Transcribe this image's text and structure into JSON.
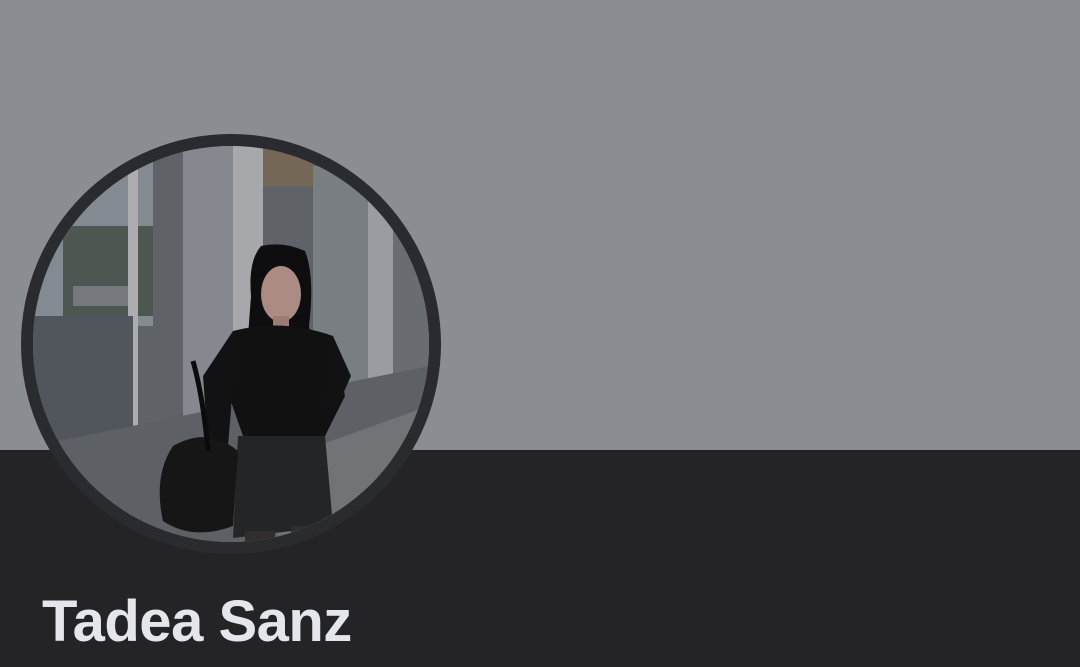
{
  "profile": {
    "name": "Tadea Sanz",
    "cover_color": "#8a8d92",
    "panel_color": "#242426",
    "avatar_icon": "profile-photo-avatar"
  }
}
